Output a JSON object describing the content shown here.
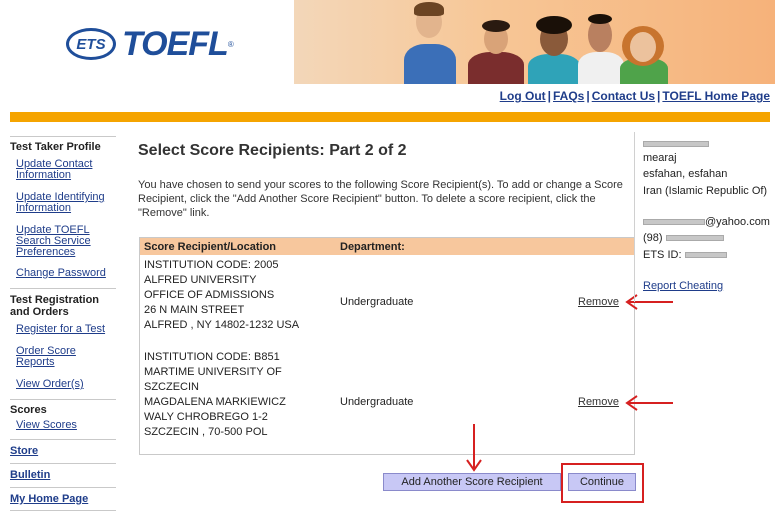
{
  "header": {
    "logo_ets": "ETS",
    "logo_toefl": "TOEFL",
    "logo_reg": "®",
    "links": [
      "Log Out",
      "FAQs",
      "Contact Us",
      "TOEFL Home Page"
    ],
    "link_separator": "|"
  },
  "sidebar": {
    "sections": [
      {
        "heading": "Test Taker Profile",
        "items": [
          "Update Contact Information",
          "Update Identifying Information",
          "Update TOEFL Search Service Preferences",
          "Change Password"
        ]
      },
      {
        "heading": "Test Registration and Orders",
        "items": [
          "Register for a Test",
          "Order Score Reports",
          "View Order(s)"
        ]
      },
      {
        "heading": "Scores",
        "items": [
          "View Scores"
        ]
      }
    ],
    "top_links": [
      "Store",
      "Bulletin",
      "My Home Page"
    ]
  },
  "main": {
    "title": "Select Score Recipients: Part 2 of 2",
    "intro": "You have chosen to send your scores to the following Score Recipient(s). To add or change a Score Recipient, click the \"Add Another Score Recipient\" button. To delete a score recipient, click the \"Remove\" link.",
    "table_headers": [
      "Score Recipient/Location",
      "Department:"
    ],
    "recipients": [
      {
        "lines": [
          "INSTITUTION CODE: 2005",
          "ALFRED UNIVERSITY",
          "OFFICE OF ADMISSIONS",
          "26 N MAIN STREET",
          "ALFRED ,  NY 14802-1232 USA"
        ],
        "department": "Undergraduate",
        "action": "Remove"
      },
      {
        "lines": [
          "INSTITUTION CODE: B851",
          "MARTIME UNIVERSITY OF",
          "SZCZECIN",
          "MAGDALENA MARKIEWICZ",
          "WALY CHROBREGO 1-2",
          "SZCZECIN ,  70-500 POL"
        ],
        "department": "Undergraduate",
        "action": "Remove"
      }
    ],
    "buttons": {
      "add": "Add Another Score Recipient",
      "continue": "Continue"
    }
  },
  "profile": {
    "name": "mearaj",
    "city": "esfahan, esfahan",
    "country": "Iran (Islamic Republic Of)",
    "email_suffix": "@yahoo.com",
    "phone_prefix": "(98)",
    "ets_id_label": "ETS ID:",
    "report_link": "Report Cheating"
  },
  "colors": {
    "accent_orange": "#f5a400",
    "link_blue": "#1f3d8a",
    "annotation_red": "#d62020",
    "table_header": "#f7c79d",
    "button_fill": "#c8c8f5"
  }
}
